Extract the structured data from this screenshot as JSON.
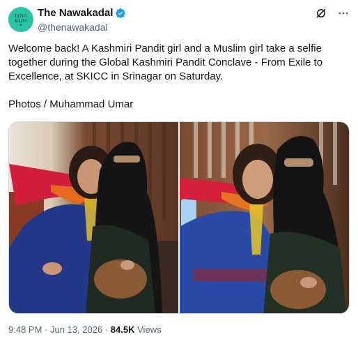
{
  "author": {
    "display_name": "The Nawakadal",
    "handle": "@thenawakadal",
    "avatar_text": "DOVA KADA",
    "avatar_color": "#29c6a5",
    "verified_color": "#1d9bf0"
  },
  "icons": {
    "grok": "grok-icon",
    "more": "more-icon",
    "verified": "verified-badge-icon"
  },
  "tweet": {
    "text": "Welcome back! A Kashmiri Pandit girl and a Muslim girl take a selfie together during the Global Kashmiri Pandit Conclave - From Exile to Excellence, at SKICC in Srinagar on Saturday.\n\nPhotos / Muhammad Umar",
    "time": "9:48 PM",
    "date": "Jun 13, 2026",
    "views_count": "84.5K",
    "views_label": "Views",
    "separator": "·"
  },
  "media": {
    "photo_count": 2
  }
}
